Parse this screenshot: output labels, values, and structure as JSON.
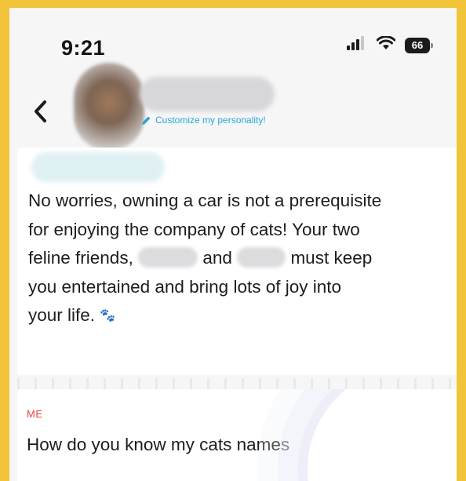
{
  "status_bar": {
    "time": "9:21",
    "battery": "66",
    "signal_icon": "cellular-signal-icon",
    "wifi_icon": "wifi-icon"
  },
  "header": {
    "back_icon": "chevron-left-icon",
    "customize_label": "Customize my personality!",
    "customize_icon": "pencil-icon",
    "link_color": "#2aa6d6"
  },
  "ai_message": {
    "line1": "No worries, owning a car is not a prerequisite",
    "line2": "for enjoying the company of cats! Your two",
    "line3_a": "feline friends,",
    "line3_b": "and",
    "line3_c": "must keep",
    "line4": "you entertained and bring lots of joy into",
    "line5": "your life.",
    "emoji": "🐾"
  },
  "user_message": {
    "label": "ME",
    "label_color": "#e0463e",
    "text": "How do you know my cats names"
  },
  "colors": {
    "outer_frame": "#f2c43a",
    "background": "#f6f6f7"
  }
}
